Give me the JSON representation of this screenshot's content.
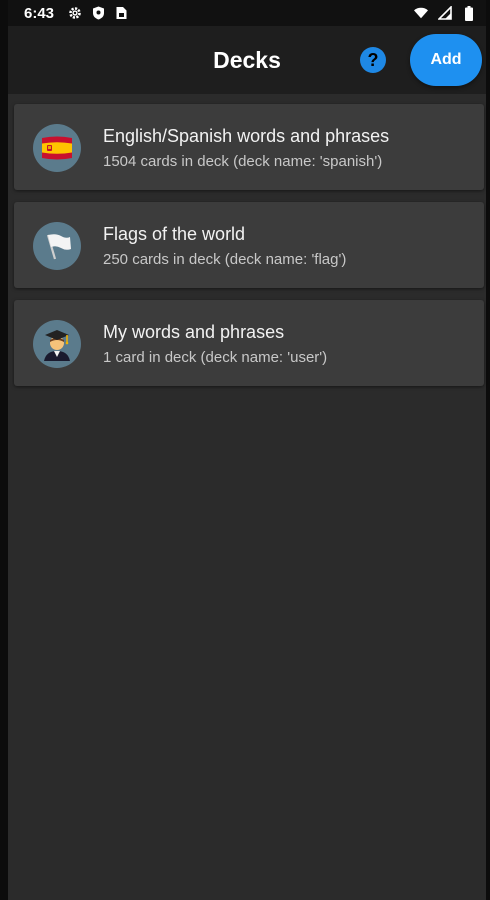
{
  "status_bar": {
    "time": "6:43",
    "left_icons": [
      "gear-icon",
      "shield-icon",
      "sim-card-icon"
    ],
    "right_icons": [
      "wifi-icon",
      "cell-signal-icon",
      "battery-icon"
    ]
  },
  "header": {
    "title": "Decks",
    "help_label": "?",
    "add_label": "Add"
  },
  "decks": [
    {
      "title": "English/Spanish words and phrases",
      "subtitle": "1504 cards in deck (deck name: 'spanish')",
      "icon": "spain-flag-icon"
    },
    {
      "title": "Flags of the world",
      "subtitle": "250 cards in deck (deck name: 'flag')",
      "icon": "white-flag-icon"
    },
    {
      "title": "My words and phrases",
      "subtitle": "1 card in deck (deck name: 'user')",
      "icon": "student-icon"
    }
  ],
  "colors": {
    "accent": "#1e90f0",
    "background": "#2b2b2b",
    "card": "#3c3c3c",
    "header": "#1e1e1e",
    "avatar": "#5b7b8c"
  }
}
